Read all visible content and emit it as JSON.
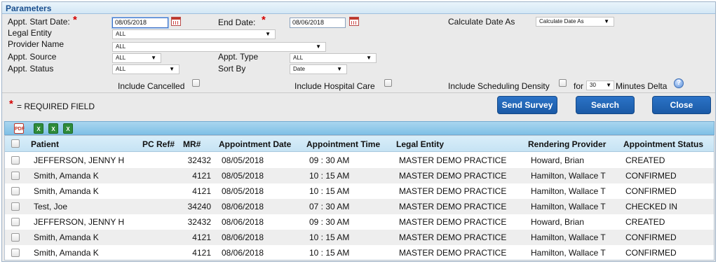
{
  "params": {
    "title": "Parameters",
    "start_date_label": "Appt. Start Date:",
    "start_date_value": "08/05/2018",
    "end_date_label": "End Date:",
    "end_date_value": "08/06/2018",
    "calc_date_label": "Calculate Date As",
    "calc_date_value": "Calculate Date As",
    "legal_entity_label": "Legal Entity",
    "legal_entity_value": "ALL",
    "provider_label": "Provider Name",
    "provider_value": "ALL",
    "source_label": "Appt. Source",
    "source_value": "ALL",
    "type_label": "Appt. Type",
    "type_value": "ALL",
    "status_label": "Appt. Status",
    "status_value": "ALL",
    "sortby_label": "Sort By",
    "sortby_value": "Date",
    "include_cancelled": "Include Cancelled",
    "include_hospital": "Include Hospital Care",
    "include_density": "Include Scheduling Density",
    "for_label": "for",
    "minutes_value": "30",
    "minutes_delta": "Minutes Delta",
    "required_star": "*",
    "required_note": "= REQUIRED FIELD"
  },
  "buttons": {
    "send_survey": "Send Survey",
    "search": "Search",
    "close": "Close"
  },
  "toolbar": {
    "pdf": "PDF",
    "xls1": "X",
    "xls2": "X",
    "xls3": "X"
  },
  "table": {
    "headers": [
      "Patient",
      "PC Ref#",
      "MR#",
      "Appointment Date",
      "Appointment Time",
      "Legal Entity",
      "Rendering Provider",
      "Appointment Status"
    ],
    "rows": [
      {
        "patient": "JEFFERSON, JENNY H",
        "pcref": "",
        "mr": "32432",
        "date": "08/05/2018",
        "time": "09 : 30 AM",
        "entity": "MASTER DEMO PRACTICE",
        "provider": "Howard, Brian",
        "status": "CREATED"
      },
      {
        "patient": "Smith, Amanda K",
        "pcref": "",
        "mr": "4121",
        "date": "08/05/2018",
        "time": "10 : 15 AM",
        "entity": "MASTER DEMO PRACTICE",
        "provider": "Hamilton, Wallace T",
        "status": "CONFIRMED"
      },
      {
        "patient": "Smith, Amanda K",
        "pcref": "",
        "mr": "4121",
        "date": "08/05/2018",
        "time": "10 : 15 AM",
        "entity": "MASTER DEMO PRACTICE",
        "provider": "Hamilton, Wallace T",
        "status": "CONFIRMED"
      },
      {
        "patient": "Test, Joe",
        "pcref": "",
        "mr": "34240",
        "date": "08/06/2018",
        "time": "07 : 30 AM",
        "entity": "MASTER DEMO PRACTICE",
        "provider": "Hamilton, Wallace T",
        "status": "CHECKED IN"
      },
      {
        "patient": "JEFFERSON, JENNY H",
        "pcref": "",
        "mr": "32432",
        "date": "08/06/2018",
        "time": "09 : 30 AM",
        "entity": "MASTER DEMO PRACTICE",
        "provider": "Howard, Brian",
        "status": "CREATED"
      },
      {
        "patient": "Smith, Amanda K",
        "pcref": "",
        "mr": "4121",
        "date": "08/06/2018",
        "time": "10 : 15 AM",
        "entity": "MASTER DEMO PRACTICE",
        "provider": "Hamilton, Wallace T",
        "status": "CONFIRMED"
      },
      {
        "patient": "Smith, Amanda K",
        "pcref": "",
        "mr": "4121",
        "date": "08/06/2018",
        "time": "10 : 15 AM",
        "entity": "MASTER DEMO PRACTICE",
        "provider": "Hamilton, Wallace T",
        "status": "CONFIRMED"
      }
    ]
  }
}
